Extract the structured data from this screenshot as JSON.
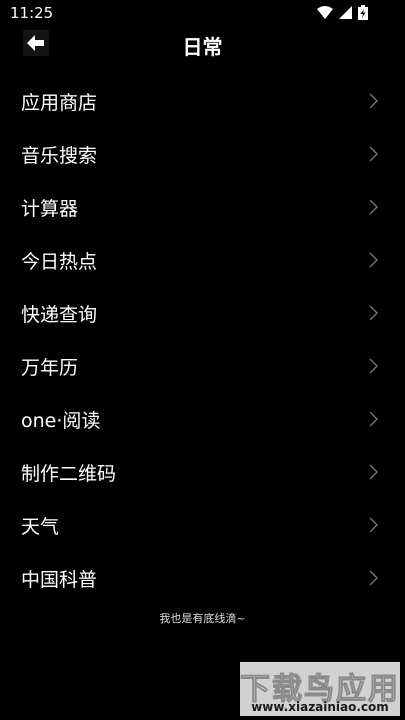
{
  "status_bar": {
    "time": "11:25",
    "icons": [
      "wifi-icon",
      "cell-signal-icon",
      "battery-charging-icon"
    ]
  },
  "header": {
    "title": "日常",
    "back_icon": "arrow-left-icon"
  },
  "menu": {
    "items": [
      {
        "label": "应用商店"
      },
      {
        "label": "音乐搜索"
      },
      {
        "label": "计算器"
      },
      {
        "label": "今日热点"
      },
      {
        "label": "快递查询"
      },
      {
        "label": "万年历"
      },
      {
        "label": "one·阅读"
      },
      {
        "label": "制作二维码"
      },
      {
        "label": "天气"
      },
      {
        "label": "中国科普"
      }
    ],
    "chevron_icon": "chevron-right-icon"
  },
  "footer": {
    "note": "我也是有底线滴~"
  },
  "watermark": {
    "text": "下载鸟应用",
    "url": "www.xiazainiao.com"
  },
  "colors": {
    "background": "#000000",
    "text": "#ffffff",
    "chevron": "#777777"
  }
}
